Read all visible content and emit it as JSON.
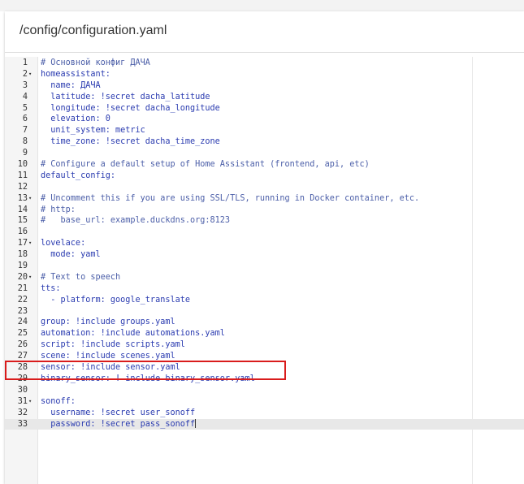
{
  "file_path": "/config/configuration.yaml",
  "lines": [
    {
      "n": "1",
      "fold": "",
      "text": "# Основной конфиг ДАЧА",
      "cls": "cmt"
    },
    {
      "n": "2",
      "fold": "▾",
      "text": "homeassistant:",
      "cls": "key"
    },
    {
      "n": "3",
      "fold": "",
      "text": "  name: ДАЧА",
      "cls": "key"
    },
    {
      "n": "4",
      "fold": "",
      "text": "  latitude: !secret dacha_latitude",
      "cls": "key"
    },
    {
      "n": "5",
      "fold": "",
      "text": "  longitude: !secret dacha_longitude",
      "cls": "key"
    },
    {
      "n": "6",
      "fold": "",
      "text": "  elevation: 0",
      "cls": "key"
    },
    {
      "n": "7",
      "fold": "",
      "text": "  unit_system: metric",
      "cls": "key"
    },
    {
      "n": "8",
      "fold": "",
      "text": "  time_zone: !secret dacha_time_zone",
      "cls": "key"
    },
    {
      "n": "9",
      "fold": "",
      "text": "",
      "cls": "val"
    },
    {
      "n": "10",
      "fold": "",
      "text": "# Configure a default setup of Home Assistant (frontend, api, etc)",
      "cls": "cmt"
    },
    {
      "n": "11",
      "fold": "",
      "text": "default_config:",
      "cls": "key"
    },
    {
      "n": "12",
      "fold": "",
      "text": "",
      "cls": "val"
    },
    {
      "n": "13",
      "fold": "▾",
      "text": "# Uncomment this if you are using SSL/TLS, running in Docker container, etc.",
      "cls": "cmt"
    },
    {
      "n": "14",
      "fold": "",
      "text": "# http:",
      "cls": "cmt"
    },
    {
      "n": "15",
      "fold": "",
      "text": "#   base_url: example.duckdns.org:8123",
      "cls": "cmt"
    },
    {
      "n": "16",
      "fold": "",
      "text": "",
      "cls": "val"
    },
    {
      "n": "17",
      "fold": "▾",
      "text": "lovelace:",
      "cls": "key"
    },
    {
      "n": "18",
      "fold": "",
      "text": "  mode: yaml",
      "cls": "key"
    },
    {
      "n": "19",
      "fold": "",
      "text": "",
      "cls": "val"
    },
    {
      "n": "20",
      "fold": "▾",
      "text": "# Text to speech",
      "cls": "cmt"
    },
    {
      "n": "21",
      "fold": "",
      "text": "tts:",
      "cls": "key"
    },
    {
      "n": "22",
      "fold": "",
      "text": "  - platform: google_translate",
      "cls": "key"
    },
    {
      "n": "23",
      "fold": "",
      "text": "",
      "cls": "val"
    },
    {
      "n": "24",
      "fold": "",
      "text": "group: !include groups.yaml",
      "cls": "key"
    },
    {
      "n": "25",
      "fold": "",
      "text": "automation: !include automations.yaml",
      "cls": "key"
    },
    {
      "n": "26",
      "fold": "",
      "text": "script: !include scripts.yaml",
      "cls": "key"
    },
    {
      "n": "27",
      "fold": "",
      "text": "scene: !include scenes.yaml",
      "cls": "key"
    },
    {
      "n": "28",
      "fold": "",
      "text": "sensor: !include sensor.yaml",
      "cls": "key"
    },
    {
      "n": "29",
      "fold": "",
      "text": "binary_sensor: ! include binary_sensor.yaml",
      "cls": "key"
    },
    {
      "n": "30",
      "fold": "",
      "text": "",
      "cls": "val"
    },
    {
      "n": "31",
      "fold": "▾",
      "text": "sonoff:",
      "cls": "key"
    },
    {
      "n": "32",
      "fold": "",
      "text": "  username: !secret user_sonoff",
      "cls": "key"
    },
    {
      "n": "33",
      "fold": "",
      "text": "  password: !secret pass_sonoff",
      "cls": "key"
    }
  ],
  "active_line": "33",
  "highlighted_line": "29"
}
